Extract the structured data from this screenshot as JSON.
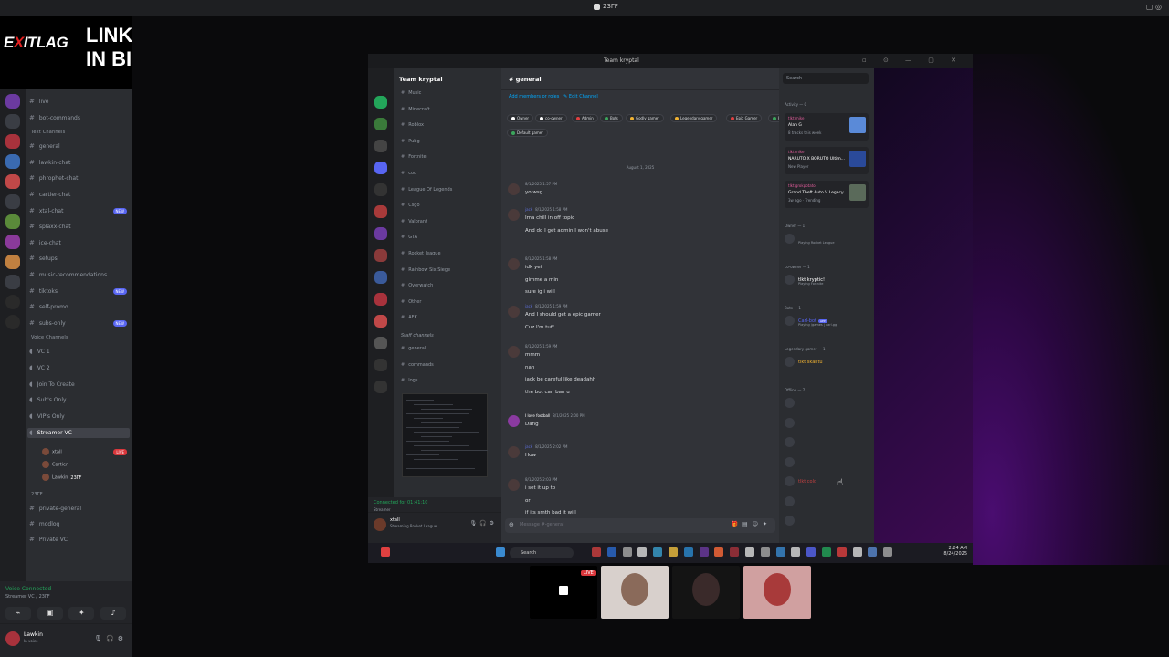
{
  "outer": {
    "window_title": "23ΓF",
    "brand": {
      "exit": "E",
      "x": "X",
      "itlag": "ITLAG",
      "link1": "LINK",
      "link2": "IN BIO"
    }
  },
  "left_sidebar": {
    "channels": [
      {
        "label": "live",
        "type": "text"
      },
      {
        "label": "bot-commands",
        "type": "text"
      },
      {
        "label": "Text Channels",
        "type": "category"
      },
      {
        "label": "general",
        "type": "text"
      },
      {
        "label": "lawkin-chat",
        "type": "text"
      },
      {
        "label": "phrophet-chat",
        "type": "text"
      },
      {
        "label": "cartier-chat",
        "type": "text"
      },
      {
        "label": "xtal-chat",
        "type": "text",
        "badge": "NEW"
      },
      {
        "label": "splaxx-chat",
        "type": "text"
      },
      {
        "label": "ice-chat",
        "type": "text"
      },
      {
        "label": "setups",
        "type": "text"
      },
      {
        "label": "music-recommendations",
        "type": "text"
      },
      {
        "label": "tiktoks",
        "type": "text",
        "badge": "NEW"
      },
      {
        "label": "self-promo",
        "type": "text"
      },
      {
        "label": "subs-only",
        "type": "text",
        "badge": "NEW"
      },
      {
        "label": "Voice Channels",
        "type": "category"
      },
      {
        "label": "VC 1",
        "type": "voice"
      },
      {
        "label": "VC 2",
        "type": "voice"
      },
      {
        "label": "Join To Create",
        "type": "voice"
      },
      {
        "label": "Sub's Only",
        "type": "voice"
      },
      {
        "label": "VIP's Only",
        "type": "voice"
      },
      {
        "label": "Streamer VC",
        "type": "voice",
        "active": true
      }
    ],
    "voice_users": [
      {
        "name": "xtall",
        "live": "LIVE"
      },
      {
        "name": "Cartier"
      },
      {
        "name": "Lawkin",
        "tag": "23ΓF"
      }
    ],
    "category2": "23ΓF",
    "channels2": [
      {
        "label": "private-general"
      },
      {
        "label": "modlog"
      },
      {
        "label": "Private VC"
      }
    ],
    "voice_status": {
      "title": "Voice Connected",
      "sub": "Streamer VC / 23ΓF"
    },
    "user": {
      "name": "Lawkin",
      "status": "In voice"
    }
  },
  "inner": {
    "window_title": "Team kryptal",
    "server_name": "Team kryptal",
    "channels": [
      "Music",
      "Minecraft",
      "Roblox",
      "Pubg",
      "Fortnite",
      "cod",
      "League Of Legends",
      "Csgo",
      "Valorant",
      "GTA",
      "Rocket league",
      "Rainbow Six Siege",
      "Overwatch",
      "Other",
      "AFK"
    ],
    "staff_category": "Staff channels",
    "staff_channels": [
      "general",
      "commands",
      "logs"
    ],
    "voice_bar": {
      "label": "Voice",
      "sub": "Streamer",
      "connected": "Connected for 01:41:10"
    },
    "user": {
      "name": "xtall",
      "status": "Streaming Rocket League"
    },
    "chat": {
      "channel": "general",
      "add_members": "Add members or roles",
      "edit_channel": "Edit Channel",
      "roles": [
        {
          "name": "Owner",
          "color": "#ffffff"
        },
        {
          "name": "co-owner",
          "color": "#ffffff"
        },
        {
          "name": "Admin",
          "color": "#e04040"
        },
        {
          "name": "Bots",
          "color": "#3ba55c"
        },
        {
          "name": "Godly gamer",
          "color": "#f0b232"
        },
        {
          "name": "Legendary gamer",
          "color": "#f0b232"
        },
        {
          "name": "Epic Gamer",
          "color": "#e04040"
        },
        {
          "name": "Pro gamer",
          "color": "#3ba55c"
        },
        {
          "name": "Default gamer",
          "color": "#3ba55c"
        }
      ],
      "date_divider": "August 1, 2025",
      "messages": [
        {
          "user": "",
          "time": "8/1/2025 1:57 PM",
          "lines": [
            "yo wsg"
          ]
        },
        {
          "user": "jack",
          "time": "8/1/2025 1:58 PM",
          "lines": [
            "Ima chill in off topic",
            "And do I get admin I won't abuse"
          ]
        },
        {
          "user": "",
          "time": "8/1/2025 1:58 PM",
          "lines": [
            "idk yet",
            "gimme a min",
            "sure ig i will"
          ]
        },
        {
          "user": "jack",
          "time": "8/1/2025 1:59 PM",
          "lines": [
            "And I should get a epic gamer",
            "Cuz I'm tuff"
          ]
        },
        {
          "user": "",
          "time": "8/1/2025 1:59 PM",
          "lines": [
            "mmm",
            "nah",
            "jack be careful like deadahh",
            "the bot can ban u"
          ]
        },
        {
          "user": "I love football",
          "time": "8/1/2025 2:00 PM",
          "lines": [
            "Dang"
          ]
        },
        {
          "user": "jack",
          "time": "8/1/2025 2:02 PM",
          "lines": [
            "How"
          ]
        },
        {
          "user": "",
          "time": "8/1/2025 2:03 PM",
          "lines": [
            "i set it up to",
            "or",
            "if its smth bad it will"
          ]
        }
      ],
      "composer_placeholder": "Message #-general"
    },
    "members": {
      "search": "Search",
      "activity_header": "Activity — 0",
      "activities": [
        {
          "user": "tlkt mike",
          "title": "Alan G",
          "sub": "8 tracks this week",
          "color": "#5a8ad8"
        },
        {
          "user": "tlkt mike",
          "title": "NARUTO X BORUTO Ultim...",
          "sub": "New Player",
          "color": "#2a4a9a"
        },
        {
          "user": "tlkt grokpotato",
          "title": "Grand Theft Auto V Legacy",
          "sub": "3w ago · Trending",
          "color": "#5a6a5a"
        }
      ],
      "groups": [
        {
          "title": "Owner — 1",
          "members": [
            {
              "name": "",
              "sub": "Playing Rocket League",
              "color": "#dbdee1"
            }
          ]
        },
        {
          "title": "co-owner — 1",
          "members": [
            {
              "name": "tlkt kryptic!",
              "sub": "Playing Fortnite",
              "color": "#ffffff"
            }
          ]
        },
        {
          "title": "Bots — 1",
          "members": [
            {
              "name": "Carl-bot",
              "sub": "Playing /games | carl.gg",
              "color": "#5865f2",
              "tag": "APP"
            }
          ]
        },
        {
          "title": "Legendary gamer — 1",
          "members": [
            {
              "name": "tlkt skantu",
              "sub": "",
              "color": "#f0b232"
            }
          ]
        },
        {
          "title": "Offline — 7",
          "members": [
            {
              "name": "",
              "sub": "",
              "color": "#6d6f78"
            },
            {
              "name": "",
              "sub": "",
              "color": "#6d6f78"
            },
            {
              "name": "",
              "sub": "",
              "color": "#6d6f78"
            },
            {
              "name": "",
              "sub": "",
              "color": "#6d6f78"
            },
            {
              "name": "tlkt cold",
              "sub": "",
              "color": "#c04040"
            },
            {
              "name": "",
              "sub": "",
              "color": "#6d6f78"
            },
            {
              "name": "",
              "sub": "",
              "color": "#6d6f78"
            }
          ]
        }
      ]
    },
    "taskbar": {
      "search": "Search",
      "time": "2:24 AM",
      "date": "8/24/2025"
    }
  },
  "webcams": {
    "live": "LIVE"
  },
  "colors": {
    "accent": "#5865f2",
    "live": "#da373c",
    "online": "#23a55a",
    "purple": "#4a0d70"
  }
}
